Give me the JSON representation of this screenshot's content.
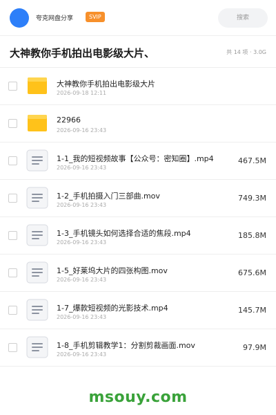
{
  "topbar": {
    "owner": "夸克网盘分享",
    "badge": "SVIP",
    "search_placeholder": "搜索"
  },
  "header": {
    "title": "大神教你手机拍出电影级大片、",
    "summary": "共 14 项 · 3.0G"
  },
  "files": [
    {
      "name": "大神教你手机拍出电影级大片",
      "date": "2026-09-18 12:11",
      "size": "",
      "icon": "folder-icon"
    },
    {
      "name": "22966",
      "date": "2026-09-16 23:43",
      "size": "",
      "icon": "folder-icon"
    },
    {
      "name": "1-1_我的短视频故事【公众号：密知圈】.mp4",
      "date": "2026-09-16 23:43",
      "size": "467.5M",
      "icon": "file-icon"
    },
    {
      "name": "1-2_手机拍摄入门三部曲.mov",
      "date": "2026-09-16 23:43",
      "size": "749.3M",
      "icon": "file-icon"
    },
    {
      "name": "1-3_手机镜头如何选择合适的焦段.mp4",
      "date": "2026-09-16 23:43",
      "size": "185.8M",
      "icon": "file-icon"
    },
    {
      "name": "1-5_好莱坞大片的四张构图.mov",
      "date": "2026-09-16 23:43",
      "size": "675.6M",
      "icon": "file-icon"
    },
    {
      "name": "1-7_爆款短视频的光影技术.mp4",
      "date": "2026-09-16 23:43",
      "size": "145.7M",
      "icon": "file-icon"
    },
    {
      "name": "1-8_手机剪辑教学1：分割剪裁画面.mov",
      "date": "2026-09-16 23:43",
      "size": "97.9M",
      "icon": "file-icon"
    }
  ],
  "watermark": "msouy.com",
  "colors": {
    "avatar": "#2d7ff9",
    "badge": "#f7902b",
    "folder": "#ffc21a",
    "watermark": "#3aa23a"
  }
}
